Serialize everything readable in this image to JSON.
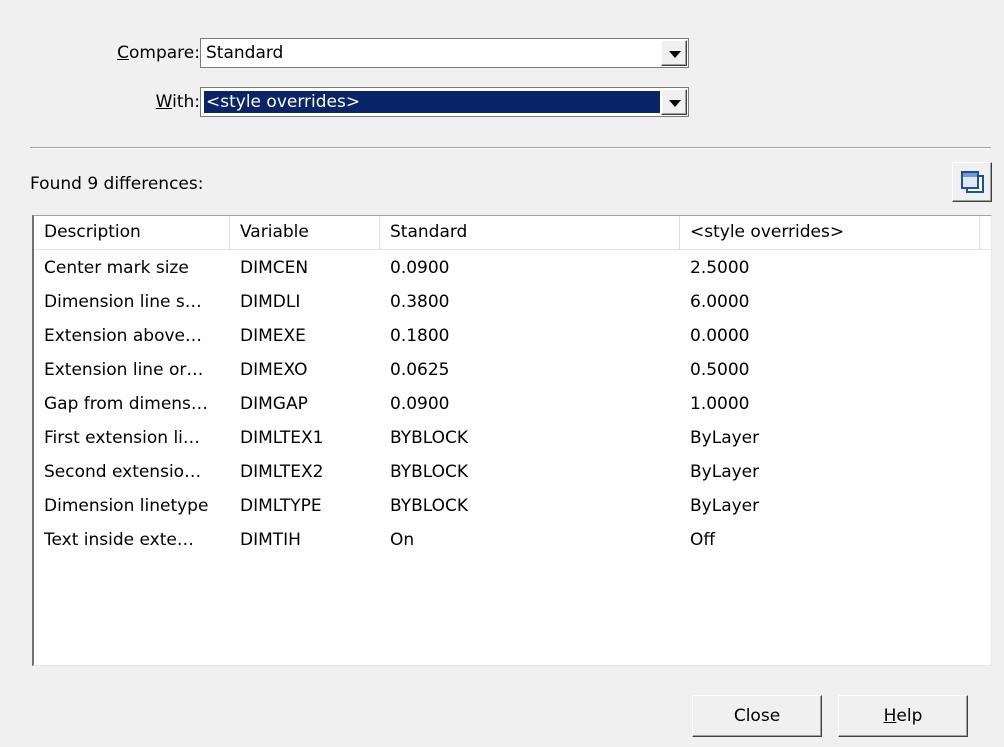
{
  "compare": {
    "label_mnemonic": "C",
    "label_rest": "ompare:",
    "value": "Standard"
  },
  "with": {
    "label_mnemonic": "W",
    "label_rest": "ith:",
    "value": "<style overrides>"
  },
  "found_text": "Found 9 differences:",
  "copy_button": {
    "icon": "copy-to-clipboard-icon"
  },
  "table": {
    "headers": [
      "Description",
      "Variable",
      "Standard",
      "<style overrides>"
    ],
    "rows": [
      [
        "Center mark size",
        "DIMCEN",
        "0.0900",
        "2.5000"
      ],
      [
        "Dimension line s…",
        "DIMDLI",
        "0.3800",
        "6.0000"
      ],
      [
        "Extension above…",
        "DIMEXE",
        "0.1800",
        "0.0000"
      ],
      [
        "Extension line or…",
        "DIMEXO",
        "0.0625",
        "0.5000"
      ],
      [
        "Gap from dimens…",
        "DIMGAP",
        "0.0900",
        "1.0000"
      ],
      [
        "First extension li…",
        "DIMLTEX1",
        "BYBLOCK",
        "ByLayer"
      ],
      [
        "Second extensio…",
        "DIMLTEX2",
        "BYBLOCK",
        "ByLayer"
      ],
      [
        "Dimension linetype",
        "DIMLTYPE",
        "BYBLOCK",
        "ByLayer"
      ],
      [
        "Text inside exte…",
        "DIMTIH",
        "On",
        "Off"
      ]
    ]
  },
  "buttons": {
    "close_label": "Close",
    "help_mnemonic": "H",
    "help_rest": "elp"
  },
  "colors": {
    "dialog_bg": "#f0f0f0",
    "selection_bg": "#0a246a",
    "selection_text": "#ffffff"
  }
}
